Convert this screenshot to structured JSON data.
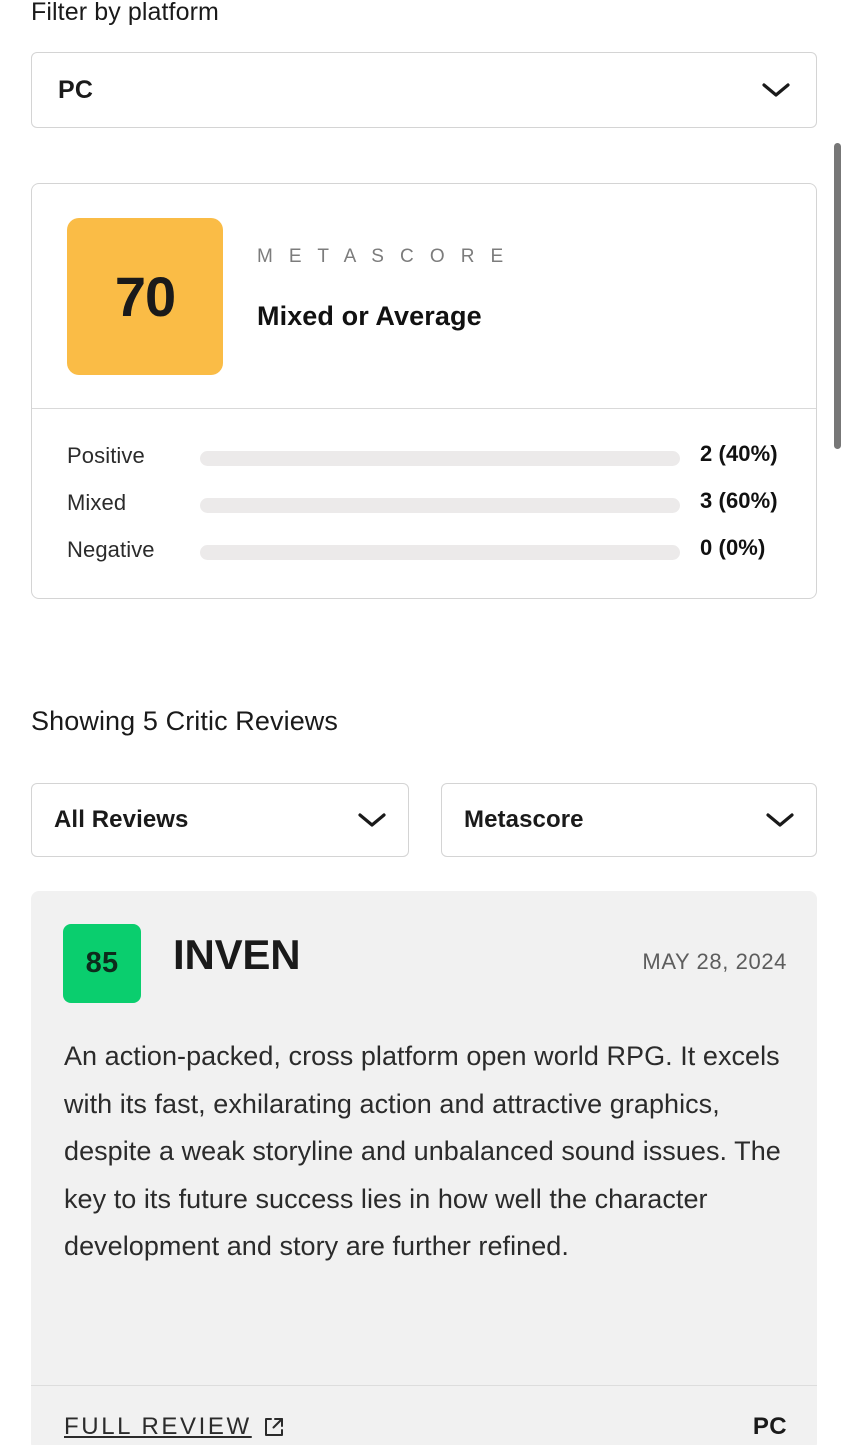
{
  "filter": {
    "label": "Filter by platform",
    "platform_select": {
      "value": "PC",
      "icon": "chevron-down-icon"
    }
  },
  "metascore_card": {
    "score": "70",
    "score_color": "#FABC46",
    "kicker": "M E T A S C O R E",
    "descriptor": "Mixed or Average",
    "sentiments": [
      {
        "label": "Positive",
        "count_text": "2 (40%)",
        "count": 2,
        "percent": 40,
        "color": "#00C775"
      },
      {
        "label": "Mixed",
        "count_text": "3 (60%)",
        "count": 3,
        "percent": 60,
        "color": "#FABC46"
      },
      {
        "label": "Negative",
        "count_text": "0 (0%)",
        "count": 0,
        "percent": 0,
        "color": "#E2484D"
      }
    ],
    "track_color": "#ECEAEA"
  },
  "reviews_section": {
    "showing_text": "Showing 5 Critic Reviews",
    "filter_select": {
      "value": "All Reviews",
      "icon": "chevron-down-icon"
    },
    "sort_select": {
      "value": "Metascore",
      "icon": "chevron-down-icon"
    },
    "reviews": [
      {
        "score": "85",
        "score_color": "#0ACE6E",
        "publication": "INVEN",
        "date": "MAY 28, 2024",
        "quote": "An action-packed, cross platform open world RPG. It excels with its fast, exhilarating action and attractive graphics, despite a weak storyline and unbalanced sound issues. The key to its future success lies in how well the character development and story are further refined.",
        "full_review_label": "FULL REVIEW",
        "full_review_icon": "external-link-icon",
        "platform": "PC"
      }
    ]
  },
  "scrollbar": {
    "thumb_color": "#777777"
  }
}
